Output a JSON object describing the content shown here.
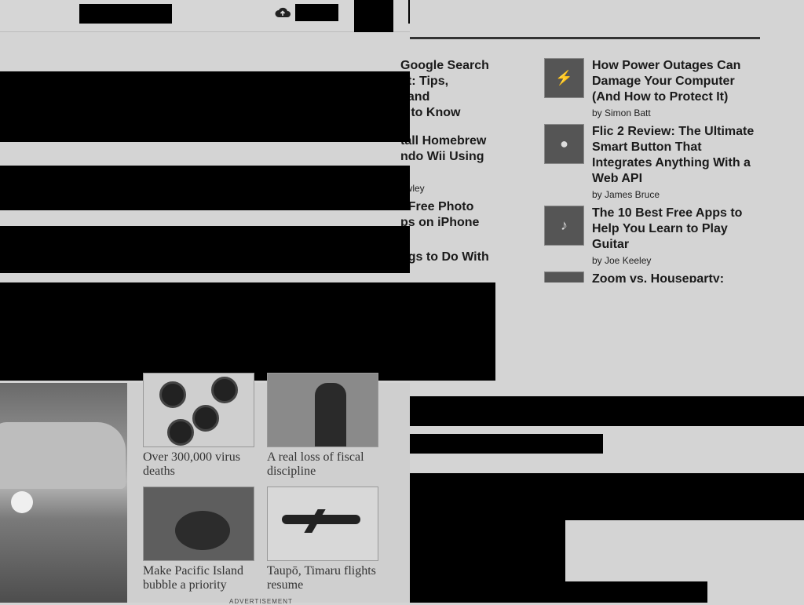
{
  "articles_left": [
    {
      "title": "Google Search\net: Tips,\n, and\ns to Know",
      "byline": ""
    },
    {
      "title": "tall Homebrew\nndo Wii Using\nb",
      "byline": "awley"
    },
    {
      "title": "t Free Photo\nps on iPhone",
      "byline": ""
    },
    {
      "title": "ngs to Do With",
      "byline": ""
    }
  ],
  "articles_right": [
    {
      "title": "How Power Outages Can Damage Your Computer (And How to Protect It)",
      "byline": "by Simon Batt",
      "icon": "computer-thumbnail-icon"
    },
    {
      "title": "Flic 2 Review: The Ultimate Smart Button That Integrates Anything With a Web API",
      "byline": "by James Bruce",
      "icon": "smart-button-thumbnail-icon"
    },
    {
      "title": "The 10 Best Free Apps to Help You Learn to Play Guitar",
      "byline": "by Joe Keeley",
      "icon": "guitar-thumbnail-icon"
    },
    {
      "title": "Zoom vs. Houseparty:",
      "byline": "",
      "icon": "video-call-thumbnail-icon"
    }
  ],
  "news_cards": [
    {
      "caption": "Over 300,000 virus deaths",
      "image": "virus-image"
    },
    {
      "caption": "A real loss of fiscal discipline",
      "image": "politician-image"
    },
    {
      "caption": "Make Pacific Island bubble a priority",
      "image": "island-image"
    },
    {
      "caption": "Taupō, Timaru flights resume",
      "image": "plane-image"
    }
  ],
  "advertisement_label": "ADVERTISEMENT",
  "header": {
    "cloud_icon": "cloud-upload-icon"
  }
}
